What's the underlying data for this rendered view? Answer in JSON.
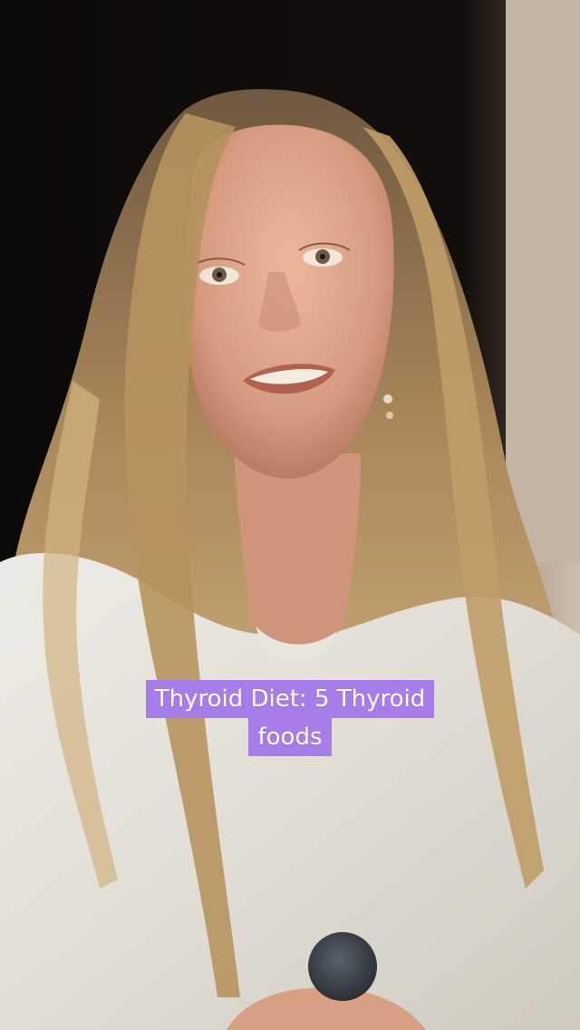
{
  "video": {
    "scene": "woman-speaking-to-camera",
    "colors": {
      "background": "#0d0b0a",
      "wall": "#c8b8a8",
      "hair": "#b08a58",
      "shirt": "#e6e3dc",
      "skin": "#d9a58b",
      "microphone": "#3b4048",
      "caption_bg": "#a77ee9"
    }
  },
  "caption": {
    "line1": "Thyroid Diet: 5 Thyroid",
    "line2": "foods"
  }
}
